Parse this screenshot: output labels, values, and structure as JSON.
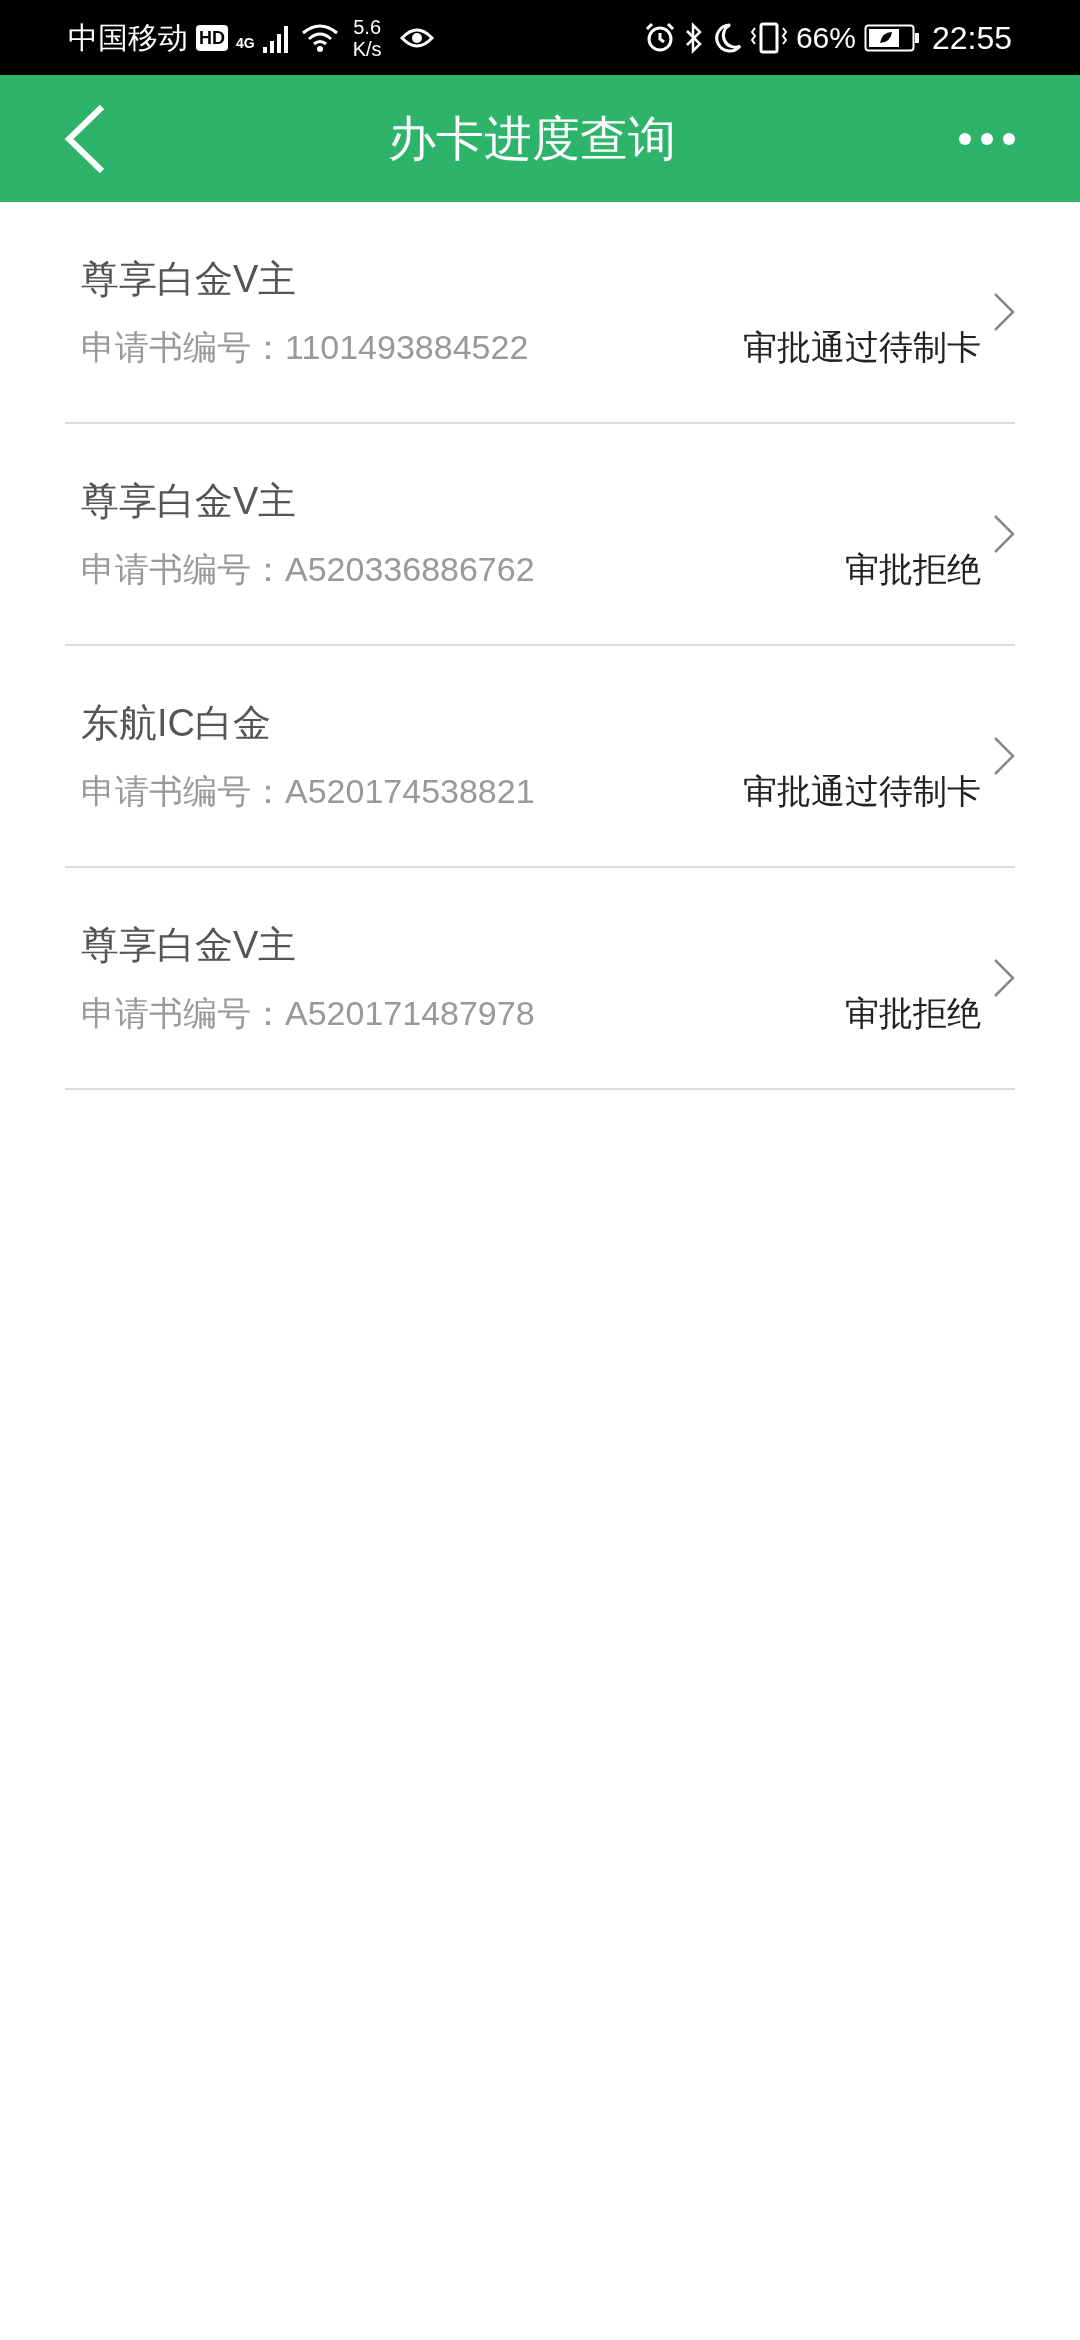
{
  "status_bar": {
    "carrier": "中国移动",
    "hd_badge": "HD",
    "network": "4G",
    "speed_value": "5.6",
    "speed_unit": "K/s",
    "battery": "66%",
    "time": "22:55"
  },
  "header": {
    "title": "办卡进度查询"
  },
  "applications": [
    {
      "card": "尊享白金V主",
      "label": "申请书编号：",
      "number": "1101493884522",
      "status": "审批通过待制卡"
    },
    {
      "card": "尊享白金V主",
      "label": "申请书编号：",
      "number": "A520336886762",
      "status": "审批拒绝"
    },
    {
      "card": "东航IC白金",
      "label": "申请书编号：",
      "number": "A520174538821",
      "status": "审批通过待制卡"
    },
    {
      "card": "尊享白金V主",
      "label": "申请书编号：",
      "number": "A520171487978",
      "status": "审批拒绝"
    }
  ]
}
